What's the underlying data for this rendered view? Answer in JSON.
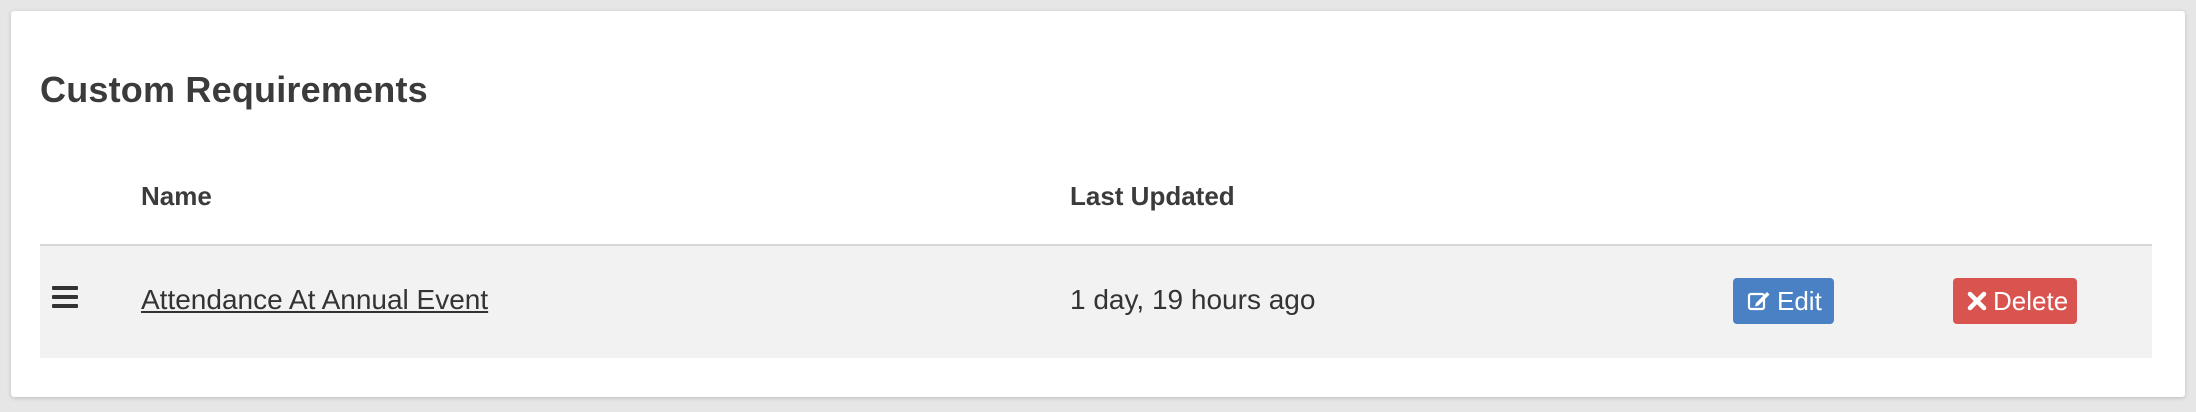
{
  "section": {
    "title": "Custom Requirements"
  },
  "table": {
    "columns": {
      "name": "Name",
      "last_updated": "Last Updated"
    },
    "rows": [
      {
        "name": "Attendance At Annual Event",
        "last_updated": "1 day, 19 hours ago",
        "edit_label": "Edit",
        "delete_label": "Delete"
      }
    ]
  },
  "colors": {
    "edit_button": "#4a80c4",
    "delete_button": "#d9534f",
    "row_background": "#f2f2f2"
  },
  "icons": {
    "drag_handle": "hamburger-icon",
    "edit": "edit-icon",
    "delete": "close-icon"
  }
}
